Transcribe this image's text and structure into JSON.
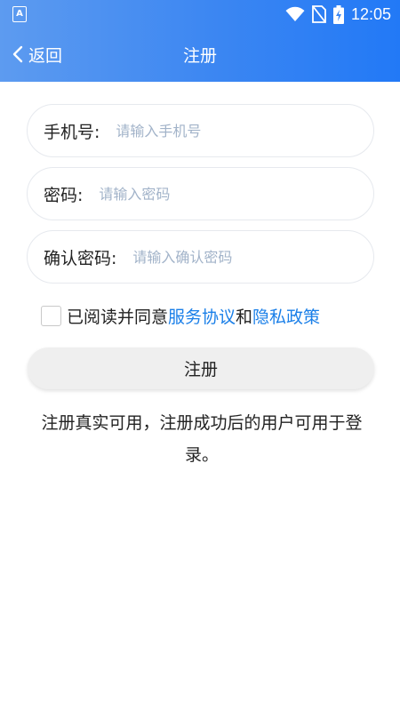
{
  "status_bar": {
    "app_icon_letter": "A",
    "time": "12:05",
    "icons": [
      "wifi-icon",
      "no-sim-icon",
      "battery-charging-icon"
    ]
  },
  "nav": {
    "back_label": "返回",
    "title": "注册"
  },
  "form": {
    "phone": {
      "label": "手机号:",
      "placeholder": "请输入手机号",
      "value": ""
    },
    "password": {
      "label": "密码:",
      "placeholder": "请输入密码",
      "value": ""
    },
    "confirm_password": {
      "label": "确认密码:",
      "placeholder": "请输入确认密码",
      "value": ""
    }
  },
  "agreement": {
    "checked": false,
    "prefix": "已阅读并同意",
    "service_link": "服务协议",
    "connector": "和",
    "privacy_link": "隐私政策"
  },
  "register_button": "注册",
  "note": "注册真实可用，注册成功后的用户可用于登录。",
  "colors": {
    "header_gradient_start": "#5d9bf0",
    "header_gradient_end": "#2279f6",
    "link": "#1a7fe8",
    "placeholder": "#a2b3c9",
    "button_bg": "#efefef"
  }
}
